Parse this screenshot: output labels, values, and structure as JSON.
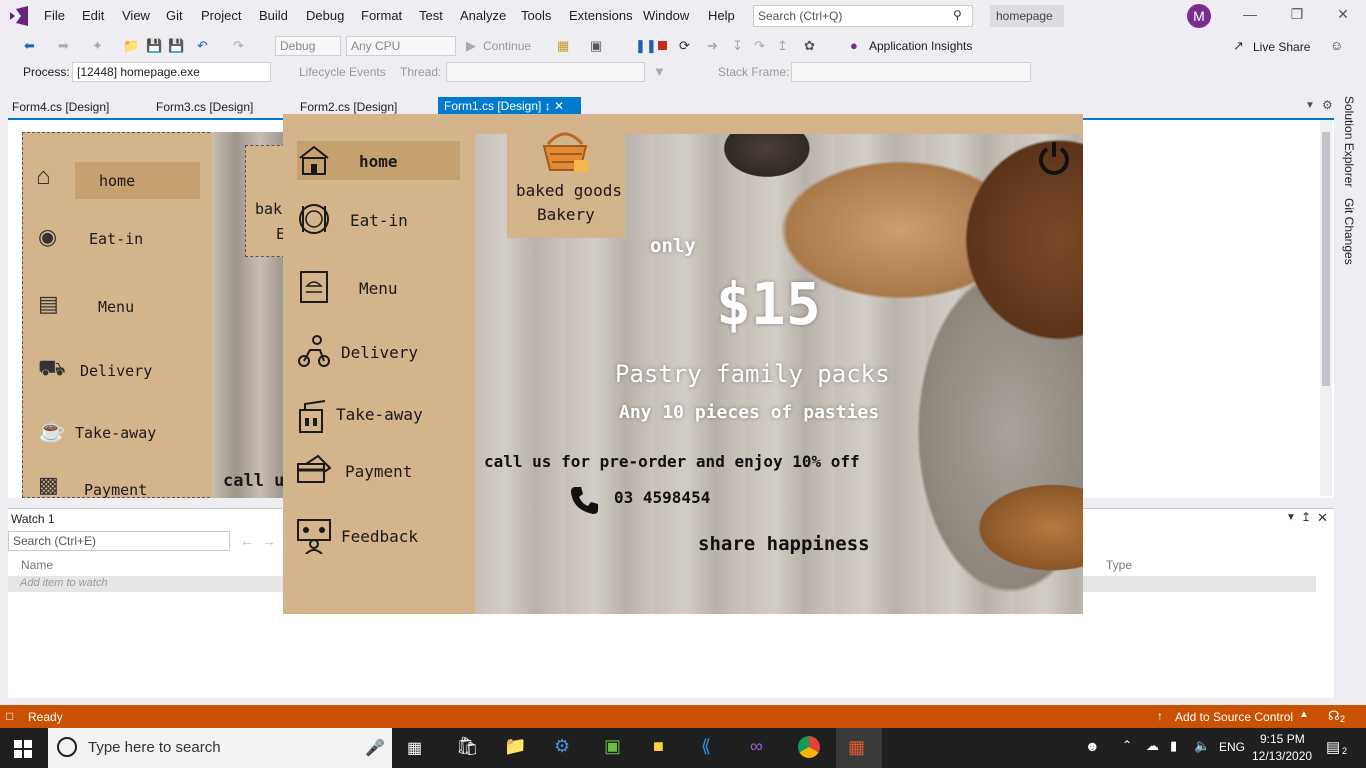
{
  "menubar": {
    "items": [
      "File",
      "Edit",
      "View",
      "Git",
      "Project",
      "Build",
      "Debug",
      "Format",
      "Test",
      "Analyze",
      "Tools",
      "Extensions",
      "Window",
      "Help"
    ],
    "search_placeholder": "Search (Ctrl+Q)",
    "solution_name": "homepage",
    "avatar_letter": "M"
  },
  "toolbar": {
    "config": "Debug",
    "platform": "Any CPU",
    "continue_label": "Continue",
    "app_insights": "Application Insights",
    "live_share": "Live Share"
  },
  "debugbar": {
    "process_label": "Process:",
    "process_value": "[12448] homepage.exe",
    "lifecycle_label": "Lifecycle Events",
    "thread_label": "Thread:",
    "stackframe_label": "Stack Frame:"
  },
  "tabs": [
    {
      "label": "Form4.cs [Design]"
    },
    {
      "label": "Form3.cs [Design]"
    },
    {
      "label": "Form2.cs [Design]"
    },
    {
      "label": "Form1.cs [Design]"
    }
  ],
  "side_panels": {
    "solution_explorer": "Solution Explorer",
    "git_changes": "Git Changes"
  },
  "watch": {
    "title": "Watch 1",
    "search_placeholder": "Search (Ctrl+E)",
    "col_name": "Name",
    "col_type": "Type",
    "add_item": "Add item to watch"
  },
  "status": {
    "ready": "Ready",
    "source_control": "Add to Source Control",
    "notifications": "2"
  },
  "taskbar": {
    "search_placeholder": "Type here to search",
    "lang": "ENG",
    "time": "9:15 PM",
    "date": "12/13/2020",
    "notif_count": "2"
  },
  "bg_form": {
    "nav": [
      "home",
      "Eat-in",
      "Menu",
      "Delivery",
      "Take-away",
      "Payment"
    ],
    "partial_text1": "bak",
    "partial_text2": "E",
    "partial_call": "call u"
  },
  "app": {
    "nav": [
      "home",
      "Eat-in",
      "Menu",
      "Delivery",
      "Take-away",
      "Payment",
      "Feedback"
    ],
    "brand_line1": "baked goods",
    "brand_line2": "Bakery",
    "only": "only",
    "price": "$15",
    "headline": "Pastry family packs",
    "subline": "Any 10 pieces of pasties",
    "call_text": "call us for pre-order and enjoy 10% off",
    "phone": "03 4598454",
    "tagline": "share happiness"
  },
  "colors": {
    "accent": "#007acc",
    "status_bar": "#ca5100",
    "form_bg": "#d4b48a",
    "nav_highlight": "#c6a06f",
    "vs_purple": "#68217a"
  }
}
